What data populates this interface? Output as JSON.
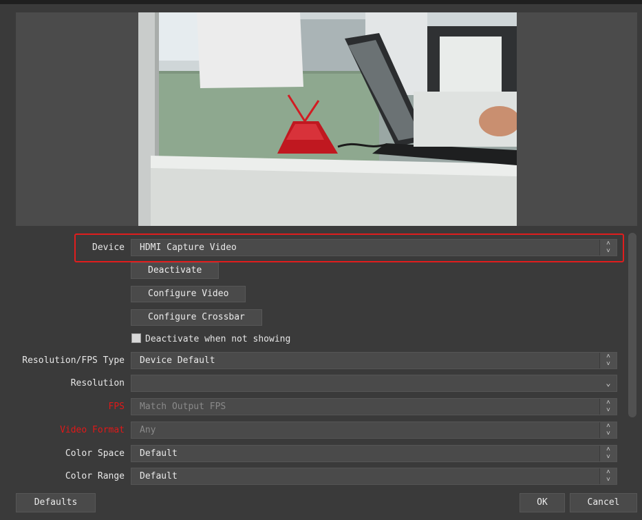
{
  "device": {
    "label": "Device",
    "value": "HDMI Capture Video"
  },
  "buttons": {
    "deactivate": "Deactivate",
    "configure_video": "Configure Video",
    "configure_crossbar": "Configure Crossbar"
  },
  "deactivate_when_not_showing": {
    "label": "Deactivate when not showing",
    "checked": false
  },
  "fields": {
    "res_fps_type": {
      "label": "Resolution/FPS Type",
      "value": "Device Default"
    },
    "resolution": {
      "label": "Resolution",
      "value": ""
    },
    "fps": {
      "label": "FPS",
      "value": "Match Output FPS"
    },
    "video_format": {
      "label": "Video Format",
      "value": "Any"
    },
    "color_space": {
      "label": "Color Space",
      "value": "Default"
    },
    "color_range": {
      "label": "Color Range",
      "value": "Default"
    }
  },
  "footer": {
    "defaults": "Defaults",
    "ok": "OK",
    "cancel": "Cancel"
  },
  "colors": {
    "highlight": "#e11d1d",
    "label_red": "#e01818"
  }
}
